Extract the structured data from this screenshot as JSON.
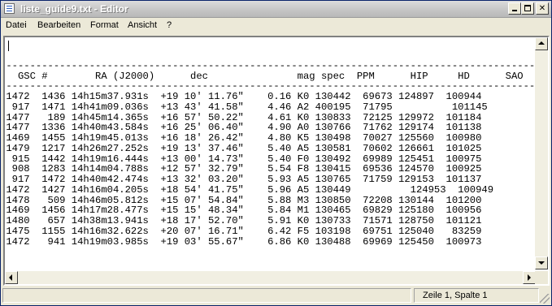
{
  "window": {
    "title": "liste_guide9.txt - Editor"
  },
  "menu": {
    "items": [
      "Datei",
      "Bearbeiten",
      "Format",
      "Ansicht",
      "?"
    ]
  },
  "editor": {
    "text": "\n-------------------------------------------------------------------------------------------------\n   GSC #        RA (J2000)      dec               mag spec  PPM      HIP     HD      SAO\n-------------------------------------------------------------------------------------------------\n 1472  1436 14h15m37.931s  +19 10' 11.76\"    0.16 K0 130442  69673 124897  100944\n  917  1471 14h41m09.036s  +13 43' 41.58\"    4.46 A2 400195  71795          101145\n 1477   189 14h45m14.365s  +16 57' 50.22\"    4.61 K0 130833  72125 129972  101184\n 1477  1336 14h40m43.584s  +16 25' 06.40\"    4.90 A0 130766  71762 129174  101138\n 1469  1455 14h19m45.013s  +16 18' 26.42\"    4.80 K5 130498  70027 125560  100980\n 1479  1217 14h26m27.252s  +19 13' 37.46\"    5.40 A5 130581  70602 126661  101025\n  915  1442 14h19m16.444s  +13 00' 14.73\"    5.40 F0 130492  69989 125451  100975\n  908  1283 14h14m04.788s  +12 57' 32.79\"    5.54 F8 130415  69536 124570  100925\n  917  1472 14h40m42.474s  +13 32' 03.20\"    5.93 A5 130765  71759 129153  101137\n 1472  1427 14h16m04.205s  +18 54' 41.75\"    5.96 A5 130449          124953  100949\n 1478   509 14h46m05.812s  +15 07' 54.84\"    5.88 M3 130850  72208 130144  101200\n 1469  1456 14h17m28.477s  +15 15' 48.34\"    5.84 M1 130465  69829 125180  100956\n 1480   657 14h38m13.941s  +18 17' 52.70\"    5.91 K0 130733  71571 128750  101121\n 1475  1155 14h16m32.622s  +20 07' 16.71\"    6.42 F5 103198  69751 125040   83259\n 1472   941 14h19m03.985s  +19 03' 55.67\"    6.86 K0 130488  69969 125450  100973"
  },
  "statusbar": {
    "position": "Zeile 1, Spalte 1"
  }
}
